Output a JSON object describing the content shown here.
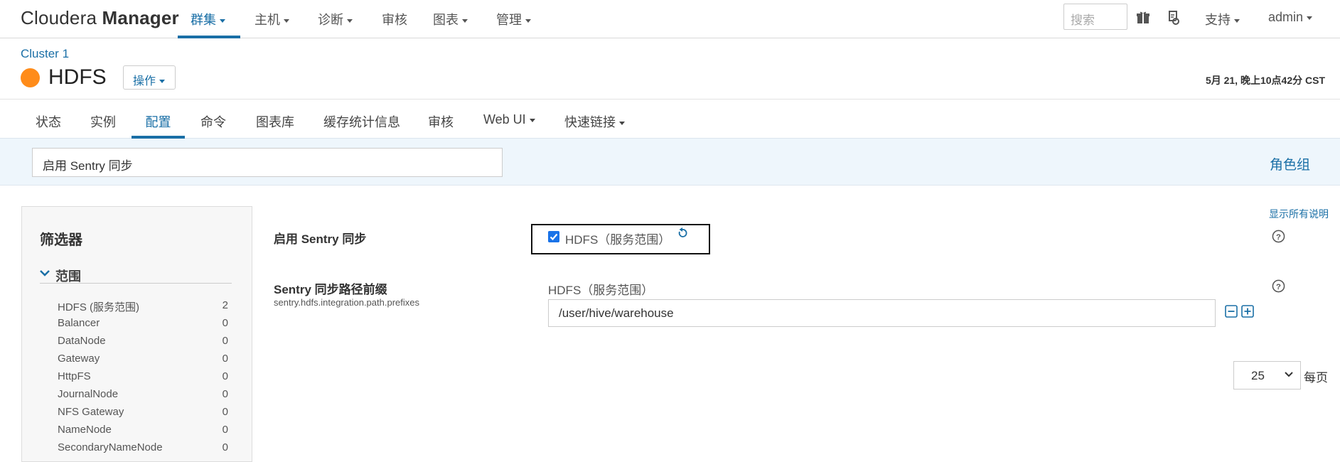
{
  "brand": {
    "name_light": "Cloudera ",
    "name_bold": "Manager"
  },
  "nav": {
    "items": [
      {
        "label": "群集",
        "dropdown": true,
        "active": true
      },
      {
        "label": "主机",
        "dropdown": true
      },
      {
        "label": "诊断",
        "dropdown": true
      },
      {
        "label": "审核",
        "dropdown": false
      },
      {
        "label": "图表",
        "dropdown": true
      },
      {
        "label": "管理",
        "dropdown": true
      }
    ],
    "search_placeholder": "搜索",
    "support_label": "支持",
    "user_label": "admin"
  },
  "service": {
    "cluster_link": "Cluster 1",
    "name": "HDFS",
    "status_color": "#ff8c1a",
    "actions_label": "操作",
    "timestamp": "5月 21, 晚上10点42分 CST"
  },
  "tabs": [
    {
      "label": "状态"
    },
    {
      "label": "实例"
    },
    {
      "label": "配置",
      "active": true
    },
    {
      "label": "命令"
    },
    {
      "label": "图表库"
    },
    {
      "label": "缓存统计信息"
    },
    {
      "label": "审核"
    },
    {
      "label": "Web UI",
      "dropdown": true
    },
    {
      "label": "快速链接",
      "dropdown": true
    }
  ],
  "config_search": {
    "value": "启用 Sentry 同步"
  },
  "role_groups_link": "角色组",
  "filter": {
    "title": "筛选器",
    "scope_label": "范围",
    "rows": [
      {
        "label": "HDFS (服务范围)",
        "count": "2"
      },
      {
        "label": "Balancer",
        "count": "0"
      },
      {
        "label": "DataNode",
        "count": "0"
      },
      {
        "label": "Gateway",
        "count": "0"
      },
      {
        "label": "HttpFS",
        "count": "0"
      },
      {
        "label": "JournalNode",
        "count": "0"
      },
      {
        "label": "NFS Gateway",
        "count": "0"
      },
      {
        "label": "NameNode",
        "count": "0"
      },
      {
        "label": "SecondaryNameNode",
        "count": "0"
      }
    ]
  },
  "show_all_desc": "显示所有说明",
  "settings": {
    "sentry_sync": {
      "name": "启用 Sentry 同步",
      "scope_label": "HDFS（服务范围）",
      "checked": true
    },
    "path_prefixes": {
      "name": "Sentry 同步路径前缀",
      "key": "sentry.hdfs.integration.path.prefixes",
      "scope_label": "HDFS（服务范围）",
      "value": "/user/hive/warehouse"
    }
  },
  "pagination": {
    "per_page_value": "25",
    "per_page_label": "每页"
  },
  "colors": {
    "accent": "#1a6fa6",
    "status_orange": "#ff8c1a"
  }
}
